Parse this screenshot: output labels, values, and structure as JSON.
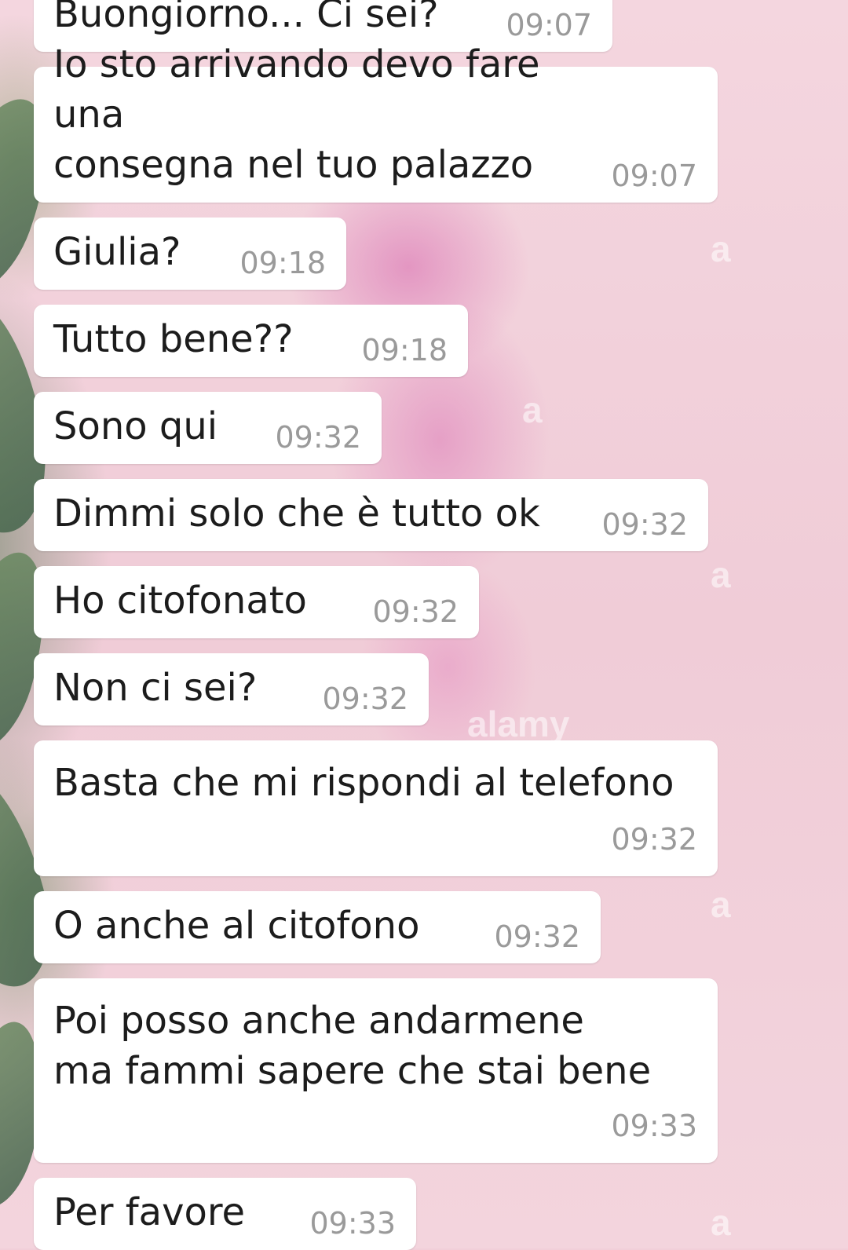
{
  "conversation": {
    "messages": [
      {
        "text": "Buongiorno... Ci sei?",
        "time": "09:07"
      },
      {
        "text": "Io sto arrivando devo fare una\nconsegna nel tuo palazzo",
        "time": "09:07"
      },
      {
        "text": "Giulia?",
        "time": "09:18"
      },
      {
        "text": "Tutto bene??",
        "time": "09:18"
      },
      {
        "text": "Sono qui",
        "time": "09:32"
      },
      {
        "text": "Dimmi solo che è tutto ok",
        "time": "09:32"
      },
      {
        "text": "Ho citofonato",
        "time": "09:32"
      },
      {
        "text": "Non ci sei?",
        "time": "09:32"
      },
      {
        "text": "Basta che mi rispondi al telefono",
        "time": "09:32"
      },
      {
        "text": "O anche al citofono",
        "time": "09:32"
      },
      {
        "text": "Poi posso anche andarmene\nma fammi sapere che stai bene",
        "time": "09:33"
      },
      {
        "text": "Per favore",
        "time": "09:33"
      }
    ]
  },
  "colors": {
    "bubble": "#ffffff",
    "text": "#1c1c1c",
    "timestamp": "#9a9a9a",
    "wallpaper": "#f1cfd9"
  }
}
